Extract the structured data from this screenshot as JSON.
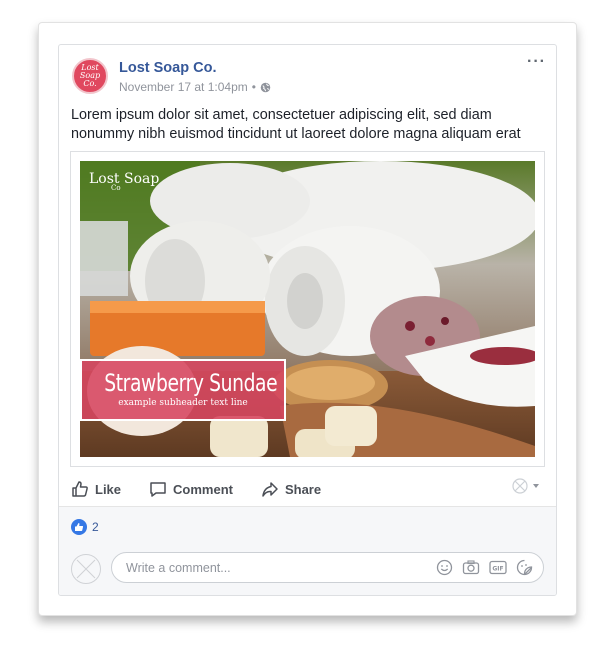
{
  "post": {
    "page_name": "Lost Soap Co.",
    "avatar_text": "Lost Soap Co.",
    "timestamp": "November 17 at 1:04pm",
    "separator": "•",
    "privacy": "public-globe-icon",
    "more_menu": "···",
    "text": "Lorem ipsum dolor sit amet, consectetuer adipiscing elit, sed diam nonummy nibh euismod tincidunt ut laoreet dolore magna aliquam erat"
  },
  "image": {
    "logo_text": "Lost Soap",
    "logo_sub": "Co",
    "overlay_title": "Strawberry Sundae",
    "overlay_subtitle": "example subheader text line"
  },
  "actions": {
    "like": "Like",
    "comment": "Comment",
    "share": "Share"
  },
  "reactions": {
    "count": "2",
    "icon": "thumbs-up-icon"
  },
  "comment_box": {
    "placeholder": "Write a comment...",
    "icons": [
      "emoji-icon",
      "camera-icon",
      "gif-icon",
      "sticker-icon"
    ]
  },
  "colors": {
    "link_blue": "#365899",
    "accent_blue": "#3578e5",
    "brand_pink": "#e0485f",
    "overlay_pink": "#d64660",
    "muted_text": "#90949c"
  }
}
